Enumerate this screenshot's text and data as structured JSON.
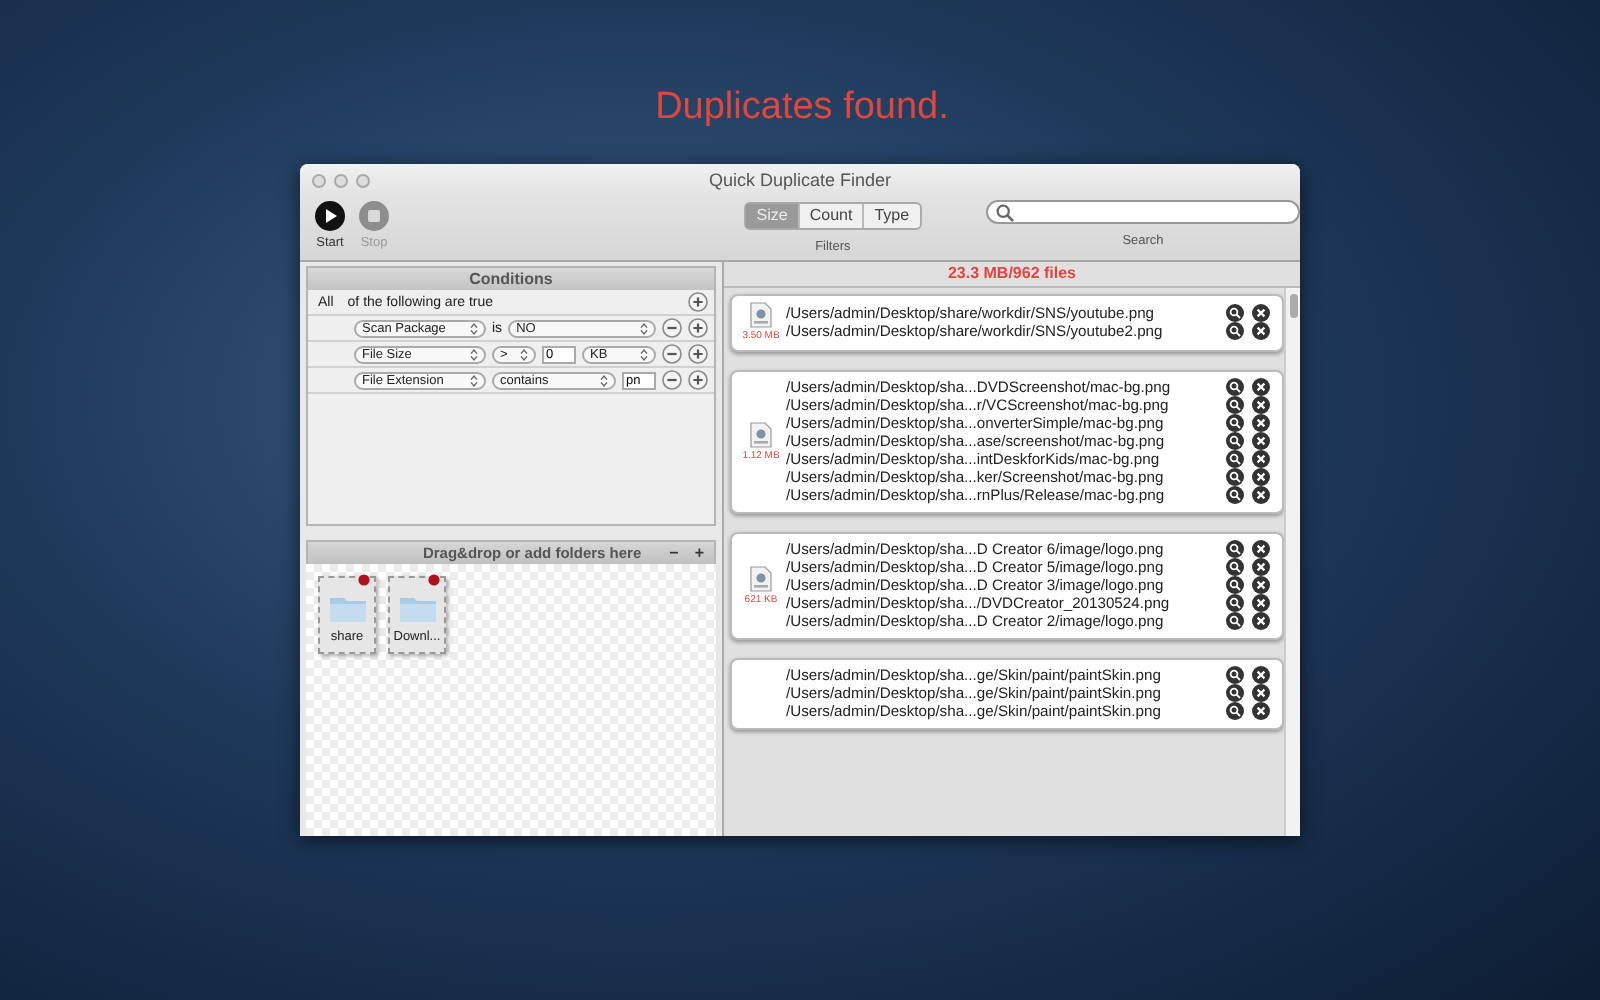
{
  "headline": "Duplicates found.",
  "window": {
    "title": "Quick Duplicate Finder"
  },
  "toolbar": {
    "buttons": [
      {
        "label": "Start",
        "kind": "start",
        "disabled": false
      },
      {
        "label": "Stop",
        "kind": "stop",
        "disabled": true
      }
    ],
    "filters": {
      "label": "Filters",
      "segments": [
        {
          "label": "Size",
          "selected": true
        },
        {
          "label": "Count",
          "selected": false
        },
        {
          "label": "Type",
          "selected": false
        }
      ]
    },
    "search": {
      "label": "Search"
    }
  },
  "conditions": {
    "title": "Conditions",
    "match": "All",
    "match_text": "of the following are true",
    "rows": [
      {
        "parts": [
          {
            "kind": "popup",
            "text": "Scan Package"
          },
          {
            "kind": "text",
            "text": "is"
          },
          {
            "kind": "popup",
            "text": "NO"
          }
        ]
      },
      {
        "parts": [
          {
            "kind": "popup",
            "text": "File Size"
          },
          {
            "kind": "popup",
            "text": ">"
          },
          {
            "kind": "field",
            "text": "0"
          },
          {
            "kind": "popup",
            "text": "KB"
          }
        ]
      },
      {
        "parts": [
          {
            "kind": "popup",
            "text": "File Extension"
          },
          {
            "kind": "popup",
            "text": "contains"
          },
          {
            "kind": "field",
            "text": "pn"
          }
        ]
      }
    ]
  },
  "folders": {
    "title": "Drag&drop or add folders here",
    "remove": "−",
    "add": "+",
    "items": [
      {
        "label": "share"
      },
      {
        "label": "Downl..."
      }
    ]
  },
  "results": {
    "summary": "23.3 MB/962 files",
    "groups": [
      {
        "size": "3.50 MB",
        "paths": [
          "/Users/admin/Desktop/share/workdir/SNS/youtube.png",
          "/Users/admin/Desktop/share/workdir/SNS/youtube2.png"
        ]
      },
      {
        "size": "1.12 MB",
        "paths": [
          "/Users/admin/Desktop/sha...DVDScreenshot/mac-bg.png",
          "/Users/admin/Desktop/sha...r/VCScreenshot/mac-bg.png",
          "/Users/admin/Desktop/sha...onverterSimple/mac-bg.png",
          "/Users/admin/Desktop/sha...ase/screenshot/mac-bg.png",
          "/Users/admin/Desktop/sha...intDeskforKids/mac-bg.png",
          "/Users/admin/Desktop/sha...ker/Screenshot/mac-bg.png",
          "/Users/admin/Desktop/sha...rnPlus/Release/mac-bg.png"
        ]
      },
      {
        "size": "621 KB",
        "paths": [
          "/Users/admin/Desktop/sha...D Creator 6/image/logo.png",
          "/Users/admin/Desktop/sha...D Creator 5/image/logo.png",
          "/Users/admin/Desktop/sha...D Creator 3/image/logo.png",
          "/Users/admin/Desktop/sha.../DVDCreator_20130524.png",
          "/Users/admin/Desktop/sha...D Creator 2/image/logo.png"
        ]
      },
      {
        "paths": [
          "/Users/admin/Desktop/sha...ge/Skin/paint/paintSkin.png",
          "/Users/admin/Desktop/sha...ge/Skin/paint/paintSkin.png",
          "/Users/admin/Desktop/sha...ge/Skin/paint/paintSkin.png"
        ]
      }
    ]
  }
}
